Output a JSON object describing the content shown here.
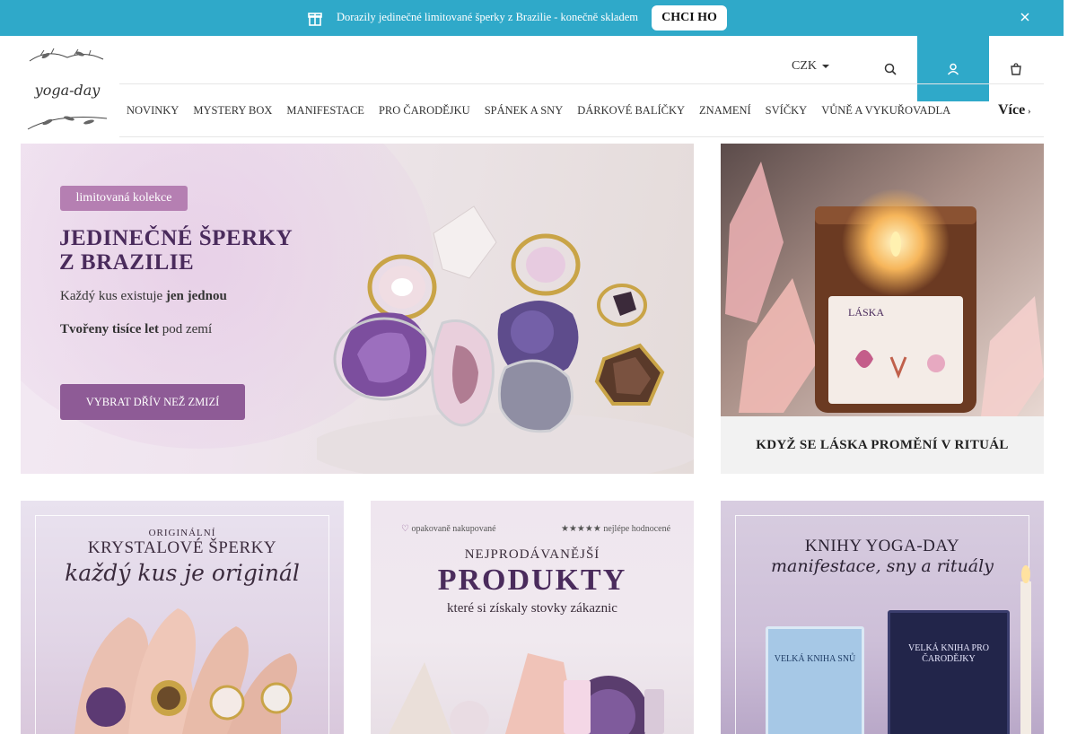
{
  "promo": {
    "message": "Dorazily jedinečné limitované šperky z Brazilie - konečně skladem",
    "cta": "CHCI HO",
    "icon": "gift-icon",
    "close_icon": "close-icon",
    "color": "#2fa9c9"
  },
  "header": {
    "logo_text": "yoga-day",
    "currency": "CZK",
    "icons": [
      "search-icon",
      "user-icon",
      "cart-icon"
    ]
  },
  "nav": {
    "items": [
      "NOVINKY",
      "MYSTERY BOX",
      "MANIFESTACE",
      "PRO ČARODĚJKU",
      "SPÁNEK A SNY",
      "DÁRKOVÉ BALÍČKY",
      "ZNAMENÍ",
      "SVÍČKY",
      "VŮNĚ A VYKUŘOVADLA"
    ],
    "more": "Více"
  },
  "hero": {
    "pill": "limitovaná kolekce",
    "title_line1": "JEDINEČNÉ ŠPERKY",
    "title_line2": "Z BRAZILIE",
    "line1_a": "Každý kus existuje ",
    "line1_b": "jen jednou",
    "line2_a": "Tvořeny tisíce let",
    "line2_b": " pod zemí",
    "button": "VYBRAT DŘÍV NEŽ ZMIZÍ"
  },
  "candle": {
    "label": "LÁSKA",
    "caption": "KDYŽ SE LÁSKA PROMĚNÍ V RITUÁL"
  },
  "tiles": {
    "jewelry": {
      "kicker": "ORIGINÁLNÍ",
      "title": "KRYSTALOVÉ ŠPERKY",
      "script": "každý kus je originál"
    },
    "bestsellers": {
      "badge1": "opakovaně nakupované",
      "badge2": "★★★★★ nejlépe hodnocené",
      "kicker": "NEJPRODÁVANĚJŠÍ",
      "title": "PRODUKTY",
      "subtitle": "které si získaly stovky zákaznic"
    },
    "books": {
      "title": "KNIHY YOGA-DAY",
      "script": "manifestace, sny a rituály",
      "book1": "VELKÁ KNIHA SNŮ",
      "book2": "VELKÁ KNIHA PRO ČARODĚJKY"
    }
  }
}
